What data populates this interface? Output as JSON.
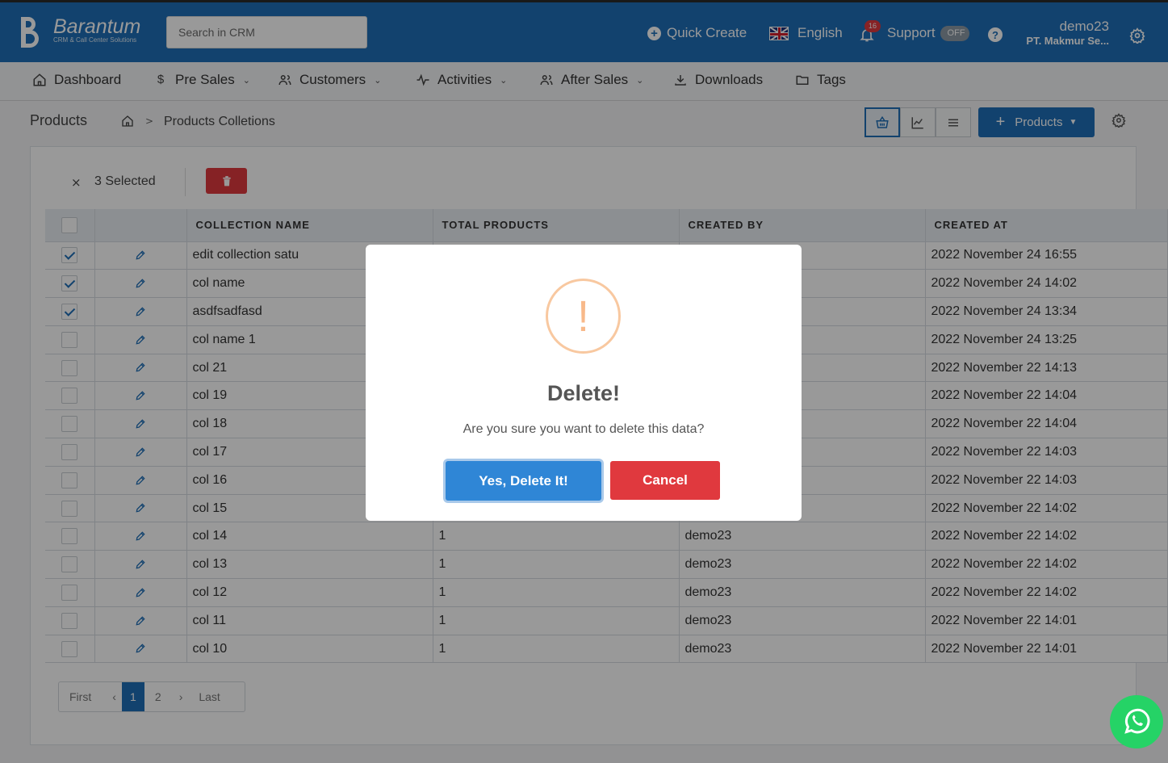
{
  "header": {
    "logo_name": "Barantum",
    "logo_tagline": "CRM & Call Center Solutions",
    "search_placeholder": "Search in CRM",
    "quick_create": "Quick Create",
    "language": "English",
    "notification_count": "16",
    "support": "Support",
    "support_toggle": "OFF",
    "help": "?",
    "user_name": "demo23",
    "user_company": "PT. Makmur Se..."
  },
  "nav": {
    "items": [
      {
        "label": "Dashboard",
        "icon": "home-icon"
      },
      {
        "label": "Pre Sales",
        "icon": "dollar-icon"
      },
      {
        "label": "Customers",
        "icon": "users-icon"
      },
      {
        "label": "Activities",
        "icon": "activity-icon"
      },
      {
        "label": "After Sales",
        "icon": "users-icon"
      },
      {
        "label": "Downloads",
        "icon": "download-icon"
      },
      {
        "label": "Tags",
        "icon": "folder-icon"
      }
    ]
  },
  "breadcrumb": {
    "title": "Products",
    "separator": ">",
    "current": "Products Colletions"
  },
  "toolbar": {
    "products_button": "Products"
  },
  "selection": {
    "close": "×",
    "count_text": "3 Selected"
  },
  "table": {
    "columns": [
      "COLLECTION NAME",
      "TOTAL PRODUCTS",
      "CREATED BY",
      "CREATED AT"
    ],
    "rows": [
      {
        "checked": true,
        "name": "edit collection satu",
        "total": "",
        "by": "",
        "at": "2022 November 24 16:55"
      },
      {
        "checked": true,
        "name": "col name",
        "total": "",
        "by": "",
        "at": "2022 November 24 14:02"
      },
      {
        "checked": true,
        "name": "asdfsadfasd",
        "total": "",
        "by": "",
        "at": "2022 November 24 13:34"
      },
      {
        "checked": false,
        "name": "col name 1",
        "total": "",
        "by": "",
        "at": "2022 November 24 13:25"
      },
      {
        "checked": false,
        "name": "col 21",
        "total": "",
        "by": "",
        "at": "2022 November 22 14:13"
      },
      {
        "checked": false,
        "name": "col 19",
        "total": "",
        "by": "",
        "at": "2022 November 22 14:04"
      },
      {
        "checked": false,
        "name": "col 18",
        "total": "",
        "by": "",
        "at": "2022 November 22 14:04"
      },
      {
        "checked": false,
        "name": "col 17",
        "total": "",
        "by": "",
        "at": "2022 November 22 14:03"
      },
      {
        "checked": false,
        "name": "col 16",
        "total": "",
        "by": "",
        "at": "2022 November 22 14:03"
      },
      {
        "checked": false,
        "name": "col 15",
        "total": "",
        "by": "",
        "at": "2022 November 22 14:02"
      },
      {
        "checked": false,
        "name": "col 14",
        "total": "1",
        "by": "demo23",
        "at": "2022 November 22 14:02"
      },
      {
        "checked": false,
        "name": "col 13",
        "total": "1",
        "by": "demo23",
        "at": "2022 November 22 14:02"
      },
      {
        "checked": false,
        "name": "col 12",
        "total": "1",
        "by": "demo23",
        "at": "2022 November 22 14:02"
      },
      {
        "checked": false,
        "name": "col 11",
        "total": "1",
        "by": "demo23",
        "at": "2022 November 22 14:01"
      },
      {
        "checked": false,
        "name": "col 10",
        "total": "1",
        "by": "demo23",
        "at": "2022 November 22 14:01"
      }
    ]
  },
  "pager": {
    "first": "First",
    "prev": "‹",
    "pages": [
      "1",
      "2"
    ],
    "current": "1",
    "next": "›",
    "last": "Last"
  },
  "modal": {
    "icon": "!",
    "title": "Delete!",
    "message": "Are you sure you want to delete this data?",
    "confirm": "Yes, Delete It!",
    "cancel": "Cancel"
  },
  "colors": {
    "brand": "#1e6fb8",
    "danger": "#e0393e",
    "confirm": "#2f86d6",
    "warning": "#f8c8a0",
    "whatsapp": "#25d366"
  }
}
